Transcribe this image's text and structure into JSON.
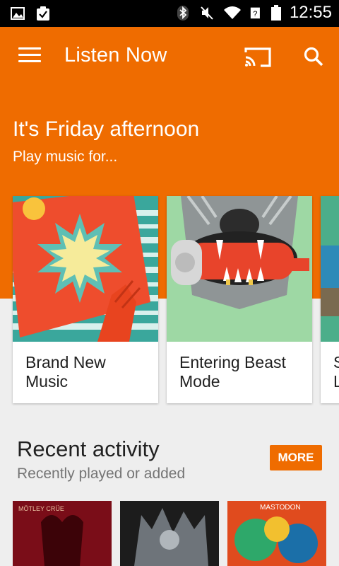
{
  "status_bar": {
    "time": "12:55",
    "icons": [
      "image-icon",
      "clipboard-check-icon",
      "bluetooth-icon",
      "mute-icon",
      "wifi-icon",
      "signal-icon",
      "battery-icon"
    ]
  },
  "app_bar": {
    "title": "Listen Now",
    "menu_icon": "hamburger-menu-icon",
    "cast_icon": "cast-icon",
    "search_icon": "search-icon",
    "color": "#ef6c00"
  },
  "hero": {
    "heading": "It's Friday afternoon",
    "subheading": "Play music for..."
  },
  "cards": [
    {
      "label": "Brand New Music"
    },
    {
      "label": "Entering Beast Mode"
    },
    {
      "label": "S L"
    }
  ],
  "recent": {
    "title": "Recent activity",
    "subtitle": "Recently played or added",
    "more_label": "MORE",
    "album_texts": [
      "MÖTLEY CRÜE",
      "MASTODON"
    ]
  }
}
